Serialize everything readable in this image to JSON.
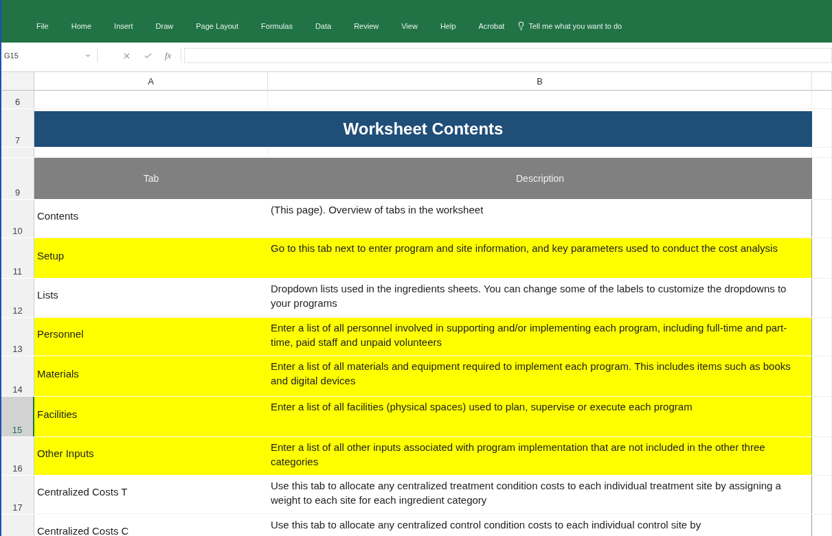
{
  "ribbon": {
    "tabs": [
      {
        "label": "File"
      },
      {
        "label": "Home"
      },
      {
        "label": "Insert"
      },
      {
        "label": "Draw"
      },
      {
        "label": "Page Layout"
      },
      {
        "label": "Formulas"
      },
      {
        "label": "Data"
      },
      {
        "label": "Review"
      },
      {
        "label": "View"
      },
      {
        "label": "Help"
      },
      {
        "label": "Acrobat"
      }
    ],
    "search": {
      "placeholder": "Tell me what you want to do"
    }
  },
  "formula_bar": {
    "name_box": "G15",
    "fx": "fx"
  },
  "columns": [
    {
      "label": "A"
    },
    {
      "label": "B"
    }
  ],
  "title_row": {
    "number": "7",
    "title": "Worksheet Contents"
  },
  "header_row": {
    "number": "9",
    "tab": "Tab",
    "description": "Description"
  },
  "rows": [
    {
      "number": "10",
      "tab": "Contents",
      "description": "(This page).  Overview of tabs in the worksheet",
      "highlighted": false,
      "selected": false
    },
    {
      "number": "11",
      "tab": "Setup",
      "description": "Go to this tab next to enter program and site information, and key parameters used to conduct the cost analysis",
      "highlighted": true,
      "selected": false
    },
    {
      "number": "12",
      "tab": "Lists",
      "description": "Dropdown lists used in the ingredients sheets. You can change some of the labels to customize the dropdowns to your programs",
      "highlighted": false,
      "selected": false
    },
    {
      "number": "13",
      "tab": "Personnel",
      "description": "Enter a list of all personnel involved in supporting and/or implementing each program, including full-time and part-time, paid staff and unpaid volunteers",
      "highlighted": true,
      "selected": false
    },
    {
      "number": "14",
      "tab": "Materials",
      "description": "Enter a list of all materials and equipment required to implement each program. This includes items such as books and digital devices",
      "highlighted": true,
      "selected": false
    },
    {
      "number": "15",
      "tab": "Facilities",
      "description": "Enter a list of all facilities (physical spaces) used to plan, supervise or execute each program",
      "highlighted": true,
      "selected": true
    },
    {
      "number": "16",
      "tab": "Other Inputs",
      "description": "Enter a list of all other inputs associated with program implementation that are not included in the other three categories",
      "highlighted": true,
      "selected": false
    },
    {
      "number": "17",
      "tab": "Centralized Costs T",
      "description": "Use this tab to allocate any centralized treatment condition costs to each individual treatment site by assigning a weight to each site for each ingredient category",
      "highlighted": false,
      "selected": false
    },
    {
      "number": "",
      "tab": "Centralized Costs C",
      "description": "Use this tab to allocate any centralized control condition costs to each individual control site by",
      "highlighted": false,
      "selected": false
    }
  ],
  "top_row_number": "6"
}
